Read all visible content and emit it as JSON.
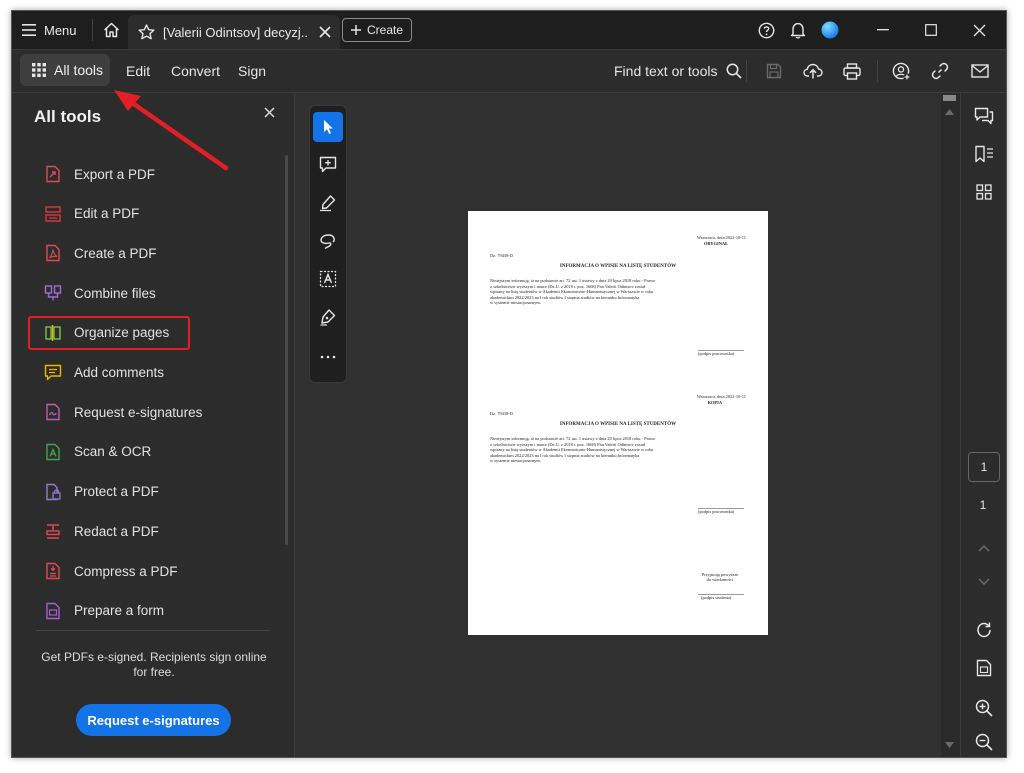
{
  "titlebar": {
    "menu_label": "Menu",
    "tab_title": "[Valerii Odintsov] decyzj...",
    "create_label": "Create"
  },
  "toolbar": {
    "all_tools_label": "All tools",
    "edit_label": "Edit",
    "convert_label": "Convert",
    "sign_label": "Sign",
    "find_label": "Find text or tools"
  },
  "panel": {
    "title": "All tools",
    "items": [
      {
        "label": "Export a PDF",
        "icon": "export-pdf-icon",
        "color": "#e34850"
      },
      {
        "label": "Edit a PDF",
        "icon": "edit-pdf-icon",
        "color": "#d7373f"
      },
      {
        "label": "Create a PDF",
        "icon": "create-pdf-icon",
        "color": "#e34850"
      },
      {
        "label": "Combine files",
        "icon": "combine-files-icon",
        "color": "#9b6fd4"
      },
      {
        "label": "Organize pages",
        "icon": "organize-pages-icon",
        "color": "#7dc242"
      },
      {
        "label": "Add comments",
        "icon": "add-comments-icon",
        "color": "#f0b400"
      },
      {
        "label": "Request e-signatures",
        "icon": "request-esignatures-icon",
        "color": "#c45ab3"
      },
      {
        "label": "Scan & OCR",
        "icon": "scan-ocr-icon",
        "color": "#3da74e"
      },
      {
        "label": "Protect a PDF",
        "icon": "protect-pdf-icon",
        "color": "#8f7bd6"
      },
      {
        "label": "Redact a PDF",
        "icon": "redact-pdf-icon",
        "color": "#e34850"
      },
      {
        "label": "Compress a PDF",
        "icon": "compress-pdf-icon",
        "color": "#e34850"
      },
      {
        "label": "Prepare a form",
        "icon": "prepare-form-icon",
        "color": "#a35fd1"
      }
    ],
    "promo_text": "Get PDFs e-signed. Recipients sign online for free.",
    "request_button": "Request e-signatures"
  },
  "document": {
    "block1": {
      "place_date": "Warszawa, dnia 2022-10-11",
      "copy_label": "ORYGINAŁ",
      "ref": "Dz. 79438-D",
      "heading": "INFORMACJA O WPISIE NA LISTĘ STUDENTÓW",
      "body": [
        "Niniejszym informuję, iż na podstawie art. 72 ust. 1 ustawy z dnia 20 lipca 2018 roku - Prawo",
        "o szkolnictwie wyższym i nauce (Dz.U. z 2018 r. poz. 1668) Pan Valerii Odintsov został",
        "wpisany na listę studentów w Akademii Ekonomiczno-Humanistycznej w Warszawie w roku",
        "akademickim 2022/2023 na I rok studiów I stopnia studiów na kierunku Informatyka",
        "w systemie niestacjonarnym."
      ],
      "sign_caption": "(podpis pracownika)"
    },
    "block2": {
      "place_date": "Warszawa, dnia 2022-10-11",
      "copy_label": "KOPIA",
      "ref": "Dz. 79438-D",
      "heading": "INFORMACJA O WPISIE NA LISTĘ STUDENTÓW",
      "body": [
        "Niniejszym informuję, iż na podstawie art. 72 ust. 1 ustawy z dnia 20 lipca 2018 roku - Prawo",
        "o szkolnictwie wyższym i nauce (Dz.U. z 2018 r. poz. 1668) Pan Valerii Odintsov został",
        "wpisany na listę studentów w Akademii Ekonomiczno-Humanistycznej w Warszawie w roku",
        "akademickim 2022/2023 na I rok studiów I stopnia studiów na kierunku Informatyka",
        "w systemie niestacjonarnym."
      ],
      "sign_caption": "(podpis pracownika)",
      "ack_line1": "Przyjmuję powyższe",
      "ack_line2": "do wiadomości",
      "student_caption": "(podpis studenta)"
    }
  },
  "rail": {
    "current_page": "1",
    "total_pages": "1"
  },
  "colors": {
    "accent": "#1473e6",
    "highlight": "#e31e24"
  }
}
